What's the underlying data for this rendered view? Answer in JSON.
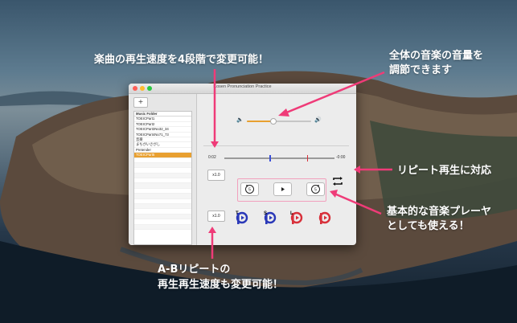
{
  "window": {
    "title": "Kosen Pronunciation Practice",
    "add_label": "+"
  },
  "playlist": {
    "header": "Music Folder",
    "items": [
      {
        "label": "TOEICPart1",
        "selected": false
      },
      {
        "label": "TOEICPart2",
        "selected": false
      },
      {
        "label": "TOEICPart3No32_34",
        "selected": false
      },
      {
        "label": "TOEICPart4No71_73",
        "selected": false
      },
      {
        "label": "音楽",
        "selected": false
      },
      {
        "label": "まちがいさがし",
        "selected": false
      },
      {
        "label": "Pretender",
        "selected": false
      },
      {
        "label": "TOEICPart5",
        "selected": true
      }
    ],
    "empty_rows": 14
  },
  "volume": {
    "level": 0.4,
    "low_icon": "speaker-low-icon",
    "high_icon": "speaker-high-icon",
    "accent": "#e8a030"
  },
  "player": {
    "time_elapsed": "0:02",
    "time_remaining": "-0:00",
    "marker_a": 0.41,
    "marker_b": 0.75,
    "speed_label": "x1.0",
    "ab_speed_label": "x1.0",
    "rewind_icon": "rewind-5-icon",
    "play_icon": "play-icon",
    "forward_icon": "forward-5-icon",
    "repeat_icon": "repeat-icon",
    "ab_buttons": [
      {
        "letter": "T",
        "icon": "ab-t-icon",
        "ring": "#2a38b8"
      },
      {
        "letter": "S",
        "icon": "ab-s-icon",
        "ring": "#2a38b8"
      },
      {
        "letter": "L",
        "icon": "ab-l-icon",
        "ring": "#d8303a"
      },
      {
        "letter": "",
        "icon": "ab-r-icon",
        "ring": "#d8303a"
      }
    ]
  },
  "captions": {
    "speed": "楽曲の再生速度を4段階で変更可能！",
    "volume_line1": "全体の音楽の音量を",
    "volume_line2": "調節できます",
    "repeat": "リピート再生に対応",
    "player_line1": "基本的な音楽プレーヤ",
    "player_line2": "としても使える！",
    "ab_line1": "A-Bリピートの",
    "ab_line2": "再生再生速度も変更可能！"
  },
  "colors": {
    "annotation_pink": "#ef3b78",
    "selection": "#e8a030",
    "marker_a": "#3a4fd8",
    "marker_b": "#d8303a"
  }
}
